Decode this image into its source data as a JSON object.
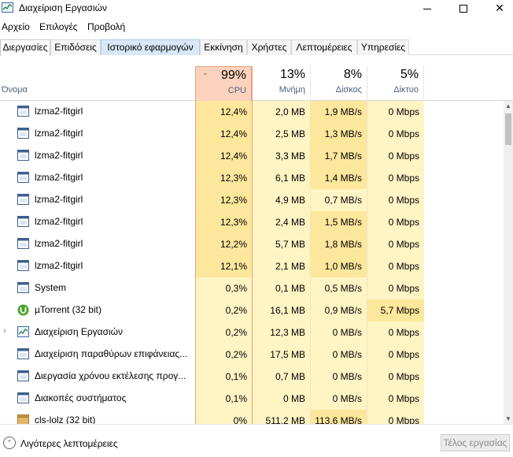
{
  "window": {
    "title": "Διαχείριση Εργασιών",
    "minimize": "—",
    "maximize": "☐",
    "close": "✕"
  },
  "menu": [
    "Αρχείο",
    "Επιλογές",
    "Προβολή"
  ],
  "tabs": [
    "Διεργασίες",
    "Επιδόσεις",
    "Ιστορικό εφαρμογών",
    "Εκκίνηση",
    "Χρήστες",
    "Λεπτομέρειες",
    "Υπηρεσίες"
  ],
  "header": {
    "name_label": "Όνομα",
    "cpu": {
      "pct": "99%",
      "label": "CPU"
    },
    "memory": {
      "pct": "13%",
      "label": "Μνήμη"
    },
    "disk": {
      "pct": "8%",
      "label": "Δίσκος"
    },
    "network": {
      "pct": "5%",
      "label": "Δίκτυο"
    }
  },
  "rows": [
    {
      "name": "lzma2-fitgirl",
      "cpu": "12,4%",
      "mem": "2,0 MB",
      "disk": "1,9 MB/s",
      "net": "0 Mbps",
      "icon": "app-window-icon"
    },
    {
      "name": "lzma2-fitgirl",
      "cpu": "12,4%",
      "mem": "2,5 MB",
      "disk": "1,3 MB/s",
      "net": "0 Mbps",
      "icon": "app-window-icon"
    },
    {
      "name": "lzma2-fitgirl",
      "cpu": "12,4%",
      "mem": "3,3 MB",
      "disk": "1,7 MB/s",
      "net": "0 Mbps",
      "icon": "app-window-icon"
    },
    {
      "name": "lzma2-fitgirl",
      "cpu": "12,3%",
      "mem": "6,1 MB",
      "disk": "1,4 MB/s",
      "net": "0 Mbps",
      "icon": "app-window-icon"
    },
    {
      "name": "lzma2-fitgirl",
      "cpu": "12,3%",
      "mem": "4,9 MB",
      "disk": "0,7 MB/s",
      "net": "0 Mbps",
      "icon": "app-window-icon"
    },
    {
      "name": "lzma2-fitgirl",
      "cpu": "12,3%",
      "mem": "2,4 MB",
      "disk": "1,5 MB/s",
      "net": "0 Mbps",
      "icon": "app-window-icon"
    },
    {
      "name": "lzma2-fitgirl",
      "cpu": "12,2%",
      "mem": "5,7 MB",
      "disk": "1,8 MB/s",
      "net": "0 Mbps",
      "icon": "app-window-icon"
    },
    {
      "name": "lzma2-fitgirl",
      "cpu": "12,1%",
      "mem": "2,1 MB",
      "disk": "1,0 MB/s",
      "net": "0 Mbps",
      "icon": "app-window-icon"
    },
    {
      "name": "System",
      "cpu": "0,3%",
      "mem": "0,1 MB",
      "disk": "0,5 MB/s",
      "net": "0 Mbps",
      "icon": "app-window-icon"
    },
    {
      "name": "µTorrent (32 bit)",
      "cpu": "0,2%",
      "mem": "16,1 MB",
      "disk": "0,9 MB/s",
      "net": "5,7 Mbps",
      "icon": "utorrent-icon"
    },
    {
      "name": "Διαχείριση Εργασιών",
      "cpu": "0,2%",
      "mem": "12,3 MB",
      "disk": "0 MB/s",
      "net": "0 Mbps",
      "icon": "task-manager-icon",
      "expander": "›"
    },
    {
      "name": "Διαχείριση παραθύρων επιφάνειας...",
      "cpu": "0,2%",
      "mem": "17,5 MB",
      "disk": "0 MB/s",
      "net": "0 Mbps",
      "icon": "app-window-icon"
    },
    {
      "name": "Διεργασία χρόνου εκτέλεσης προγ...",
      "cpu": "0,1%",
      "mem": "0,7 MB",
      "disk": "0 MB/s",
      "net": "0 Mbps",
      "icon": "app-window-icon"
    },
    {
      "name": "Διακοπές συστήματος",
      "cpu": "0,1%",
      "mem": "0 MB",
      "disk": "0 MB/s",
      "net": "0 Mbps",
      "icon": "app-window-icon"
    },
    {
      "name": "cls-lolz (32 bit)",
      "cpu": "0%",
      "mem": "511,2 MB",
      "disk": "113,6 MB/s",
      "net": "0 Mbps",
      "icon": "package-icon"
    }
  ],
  "footer": {
    "fewer_details": "Λιγότερες λεπτομέρειες",
    "end_task": "Τέλος εργασίας"
  },
  "colors": {
    "cpu_hot": "#fde79c",
    "cell_warm": "#fff4c4",
    "cpu_header": "#fbd2bd",
    "accent_border": "#e9a27a"
  }
}
